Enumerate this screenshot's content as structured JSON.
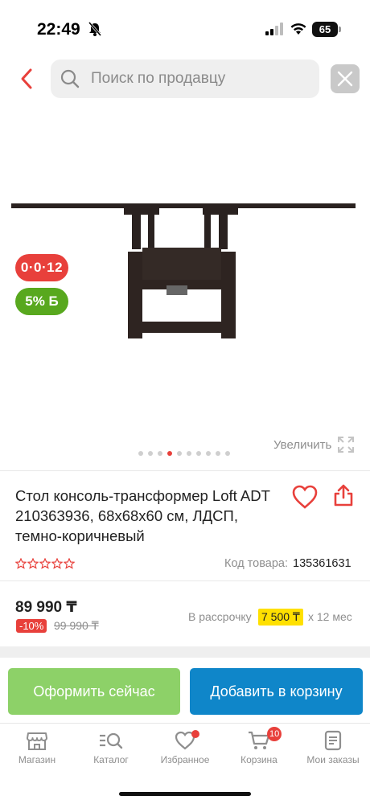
{
  "status_bar": {
    "time": "22:49",
    "battery": "65"
  },
  "search": {
    "placeholder": "Поиск по продавцу"
  },
  "badges": {
    "timer": "0·0·12",
    "bonus": "5% Б"
  },
  "gallery": {
    "zoom_label": "Увеличить",
    "dot_count": 10,
    "active_dot": 3
  },
  "product": {
    "title": "Стол консоль-трансформер Loft ADT 210363936, 68x68x60 см, ЛДСП, темно-коричневый",
    "rating_stars": 0,
    "sku_label": "Код товара:",
    "sku_value": "135361631",
    "price": "89 990 ₸",
    "discount": "-10%",
    "old_price": "99 990 ₸",
    "installment_label": "В рассрочку",
    "installment_amount": "7 500 ₸",
    "installment_months": "x 12 мес"
  },
  "actions": {
    "order_now": "Оформить сейчас",
    "add_to_cart": "Добавить в корзину"
  },
  "nav": {
    "items": [
      {
        "label": "Магазин",
        "icon": "shop-icon"
      },
      {
        "label": "Каталог",
        "icon": "catalog-search-icon"
      },
      {
        "label": "Избранное",
        "icon": "heart-icon"
      },
      {
        "label": "Корзина",
        "icon": "cart-icon",
        "badge": "10"
      },
      {
        "label": "Мои заказы",
        "icon": "orders-icon"
      }
    ]
  },
  "colors": {
    "accent_red": "#e8403b",
    "bonus_green": "#58a81e",
    "order_green": "#8dd168",
    "cart_blue": "#0f86c9",
    "installment_yellow": "#ffe000"
  }
}
